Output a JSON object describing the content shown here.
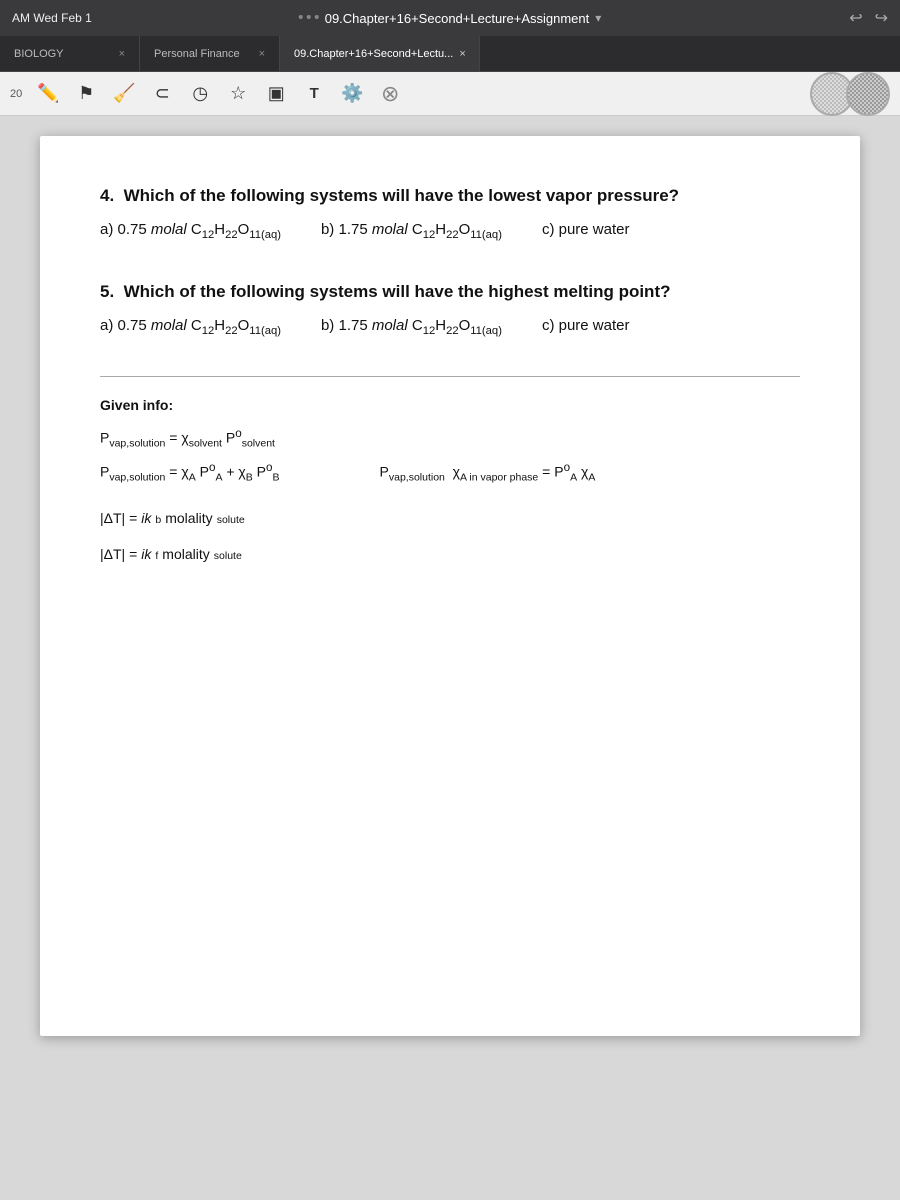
{
  "menubar": {
    "datetime": "AM  Wed Feb 1",
    "title": "09.Chapter+16+Second+Lecture+Assignment",
    "title_chevron": "▾",
    "back_icon": "↩",
    "forward_icon": "↪"
  },
  "tabs": [
    {
      "label": "BIOLOGY",
      "active": false,
      "close": "×"
    },
    {
      "label": "Personal Finance",
      "active": false,
      "close": "×"
    },
    {
      "label": "09.Chapter+16+Second+Lectu",
      "active": true,
      "close": "×"
    }
  ],
  "toolbar": {
    "label": "20"
  },
  "questions": [
    {
      "number": "4.",
      "text": "Which of the following systems will have the lowest vapor pressure?",
      "options": [
        "a) 0.75 molal C₁₂H₂₂O₁₁(aq)",
        "b) 1.75 molal C₁₂H₂₂O₁₁(aq)",
        "c) pure water"
      ]
    },
    {
      "number": "5.",
      "text": "Which of the following systems will have the highest melting point?",
      "options": [
        "a) 0.75 molal C₁₂H₂₂O₁₁(aq)",
        "b) 1.75 molal C₁₂H₂₂O₁₁(aq)",
        "c) pure water"
      ]
    }
  ],
  "given_info": {
    "title": "Given info:",
    "formulas": [
      {
        "id": "f1",
        "text": "P_vap,solution = χ_solvent P°_solvent"
      },
      {
        "id": "f2",
        "left": "P_vap,solution = χ_A P°_A + χ_B P°_B",
        "right": "P_vap,solution  χ_A in vapor phase = P°_A χ_A"
      }
    ],
    "delta_formulas": [
      "|ΔT| = ikb molality_solute",
      "|ΔT| = ikf molality_solute"
    ]
  }
}
